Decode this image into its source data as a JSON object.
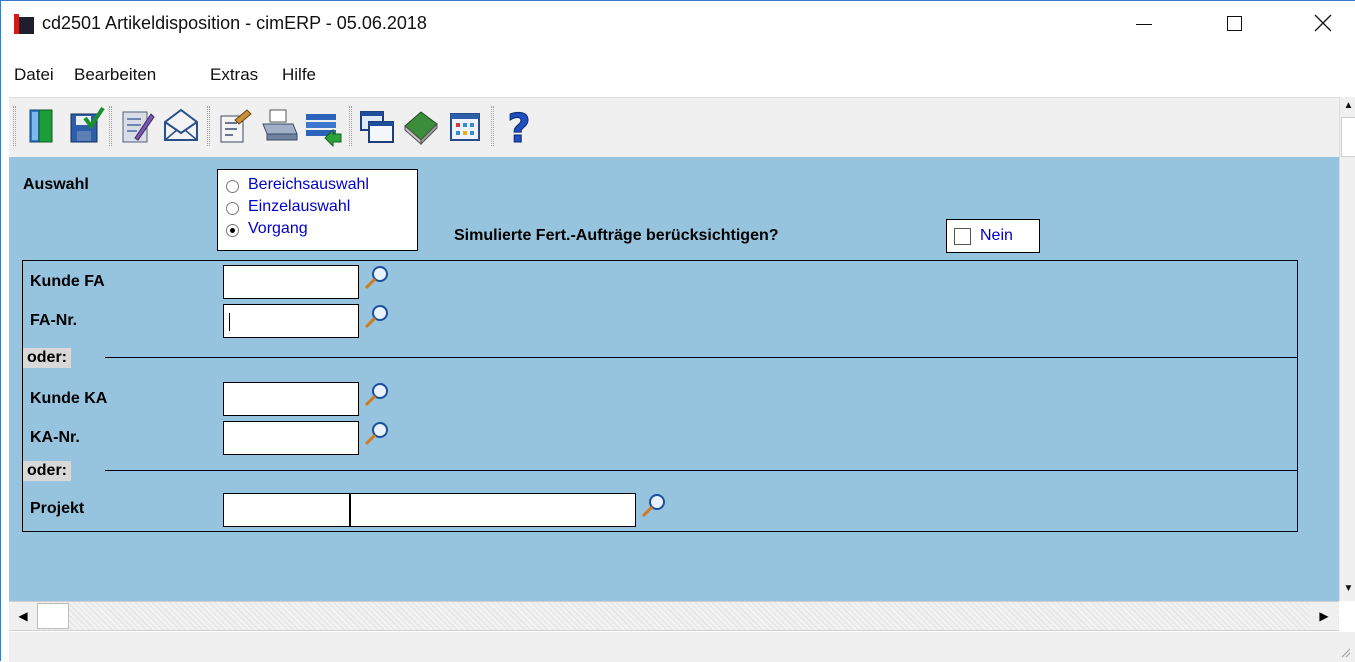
{
  "window": {
    "title": "cd2501 Artikeldisposition - cimERP - 05.06.2018"
  },
  "menu": [
    "Datei",
    "Bearbeiten",
    "Extras",
    "Hilfe"
  ],
  "toolbar": {
    "icons": [
      "exit-door-icon",
      "save-check-icon",
      "edit-checklist-icon",
      "mail-icon",
      "properties-icon",
      "print-icon",
      "export-list-icon",
      "windows-icon",
      "book-icon",
      "calendar-icon",
      "help-icon"
    ]
  },
  "form": {
    "auswahl_label": "Auswahl",
    "radio_options": [
      "Bereichsauswahl",
      "Einzelauswahl",
      "Vorgang"
    ],
    "radio_selected": "Vorgang",
    "simulated_label": "Simulierte Fert.-Aufträge berücksichtigen?",
    "simulated_value": "Nein",
    "kunde_fa_label": "Kunde FA",
    "fa_nr_label": "FA-Nr.",
    "oder_label_1": "oder:",
    "kunde_ka_label": "Kunde KA",
    "ka_nr_label": "KA-Nr.",
    "oder_label_2": "oder:",
    "projekt_label": "Projekt",
    "values": {
      "kunde_fa": "",
      "fa_nr": "",
      "kunde_ka": "",
      "ka_nr": "",
      "projekt_nr": "",
      "projekt_name": ""
    }
  },
  "colors": {
    "form_background": "#96c3de",
    "option_text": "#0000cc",
    "app_icon_red": "#d11a1a"
  }
}
